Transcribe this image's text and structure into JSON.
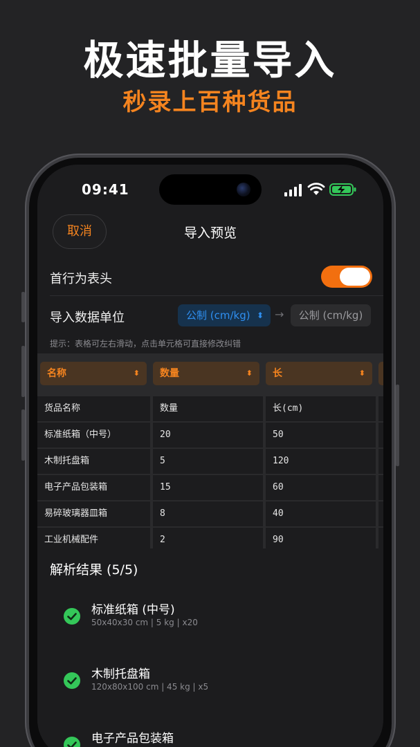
{
  "hero": {
    "title": "极速批量导入",
    "subtitle": "秒录上百种货品"
  },
  "status_bar": {
    "time": "09:41",
    "icons": [
      "signal-icon",
      "wifi-icon",
      "battery-charging-icon"
    ]
  },
  "nav": {
    "cancel_label": "取消",
    "title": "导入预览"
  },
  "settings": {
    "header_row_label": "首行为表头",
    "header_row_enabled": true,
    "unit_label": "导入数据单位",
    "unit_source": "公制 (cm/kg)",
    "unit_target": "公制 (cm/kg)",
    "hint": "提示：表格可左右滑动，点击单元格可直接修改纠错"
  },
  "table": {
    "columns": [
      {
        "label": "名称"
      },
      {
        "label": "数量"
      },
      {
        "label": "长"
      }
    ],
    "rows": [
      [
        "货品名称",
        "数量",
        "长(cm)"
      ],
      [
        "标准纸箱（中号）",
        "20",
        "50"
      ],
      [
        "木制托盘箱",
        "5",
        "120"
      ],
      [
        "电子产品包装箱",
        "15",
        "60"
      ],
      [
        "易碎玻璃器皿箱",
        "8",
        "40"
      ],
      [
        "工业机械配件",
        "2",
        "90"
      ]
    ]
  },
  "results": {
    "title": "解析结果 (5/5)",
    "items": [
      {
        "name": "标准纸箱 (中号)",
        "meta": "50x40x30 cm | 5 kg | x20"
      },
      {
        "name": "木制托盘箱",
        "meta": "120x80x100 cm | 45 kg | x5"
      },
      {
        "name": "电子产品包装箱",
        "meta": ""
      }
    ]
  },
  "colors": {
    "accent": "#f5841f",
    "toggle_on": "#f26f0f",
    "link_blue": "#2f8ff0",
    "success": "#34c759",
    "background": "#232325",
    "screen": "#1c1c1e"
  }
}
